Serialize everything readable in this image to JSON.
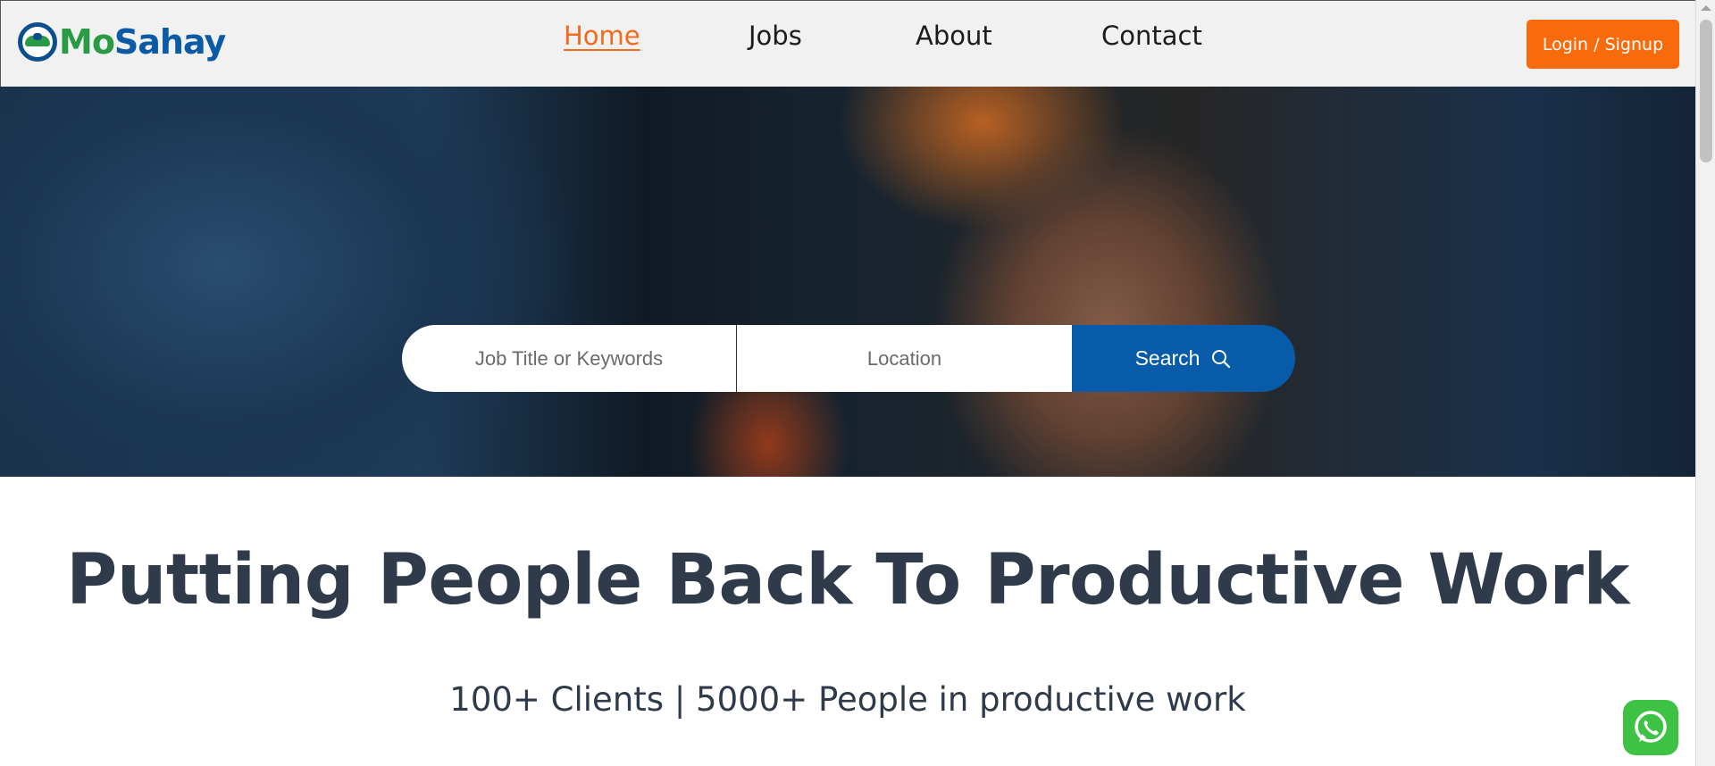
{
  "brand": {
    "name_part1": "Mo",
    "name_part2": "Sahay"
  },
  "nav": {
    "home": "Home",
    "jobs": "Jobs",
    "about": "About",
    "contact": "Contact"
  },
  "header": {
    "login_label": "Login / Signup"
  },
  "search": {
    "keywords_placeholder": "Job Title or Keywords",
    "location_placeholder": "Location",
    "button_label": "Search",
    "icon": "search-icon"
  },
  "content": {
    "headline": "Putting People Back To Productive Work",
    "subline": "100+ Clients | 5000+ People in productive work"
  },
  "colors": {
    "accent_orange": "#f76b0d",
    "brand_blue": "#0b5aa5",
    "brand_green": "#2a9a45",
    "whatsapp_green": "#3ec243"
  },
  "floating": {
    "whatsapp_icon": "whatsapp-icon"
  }
}
